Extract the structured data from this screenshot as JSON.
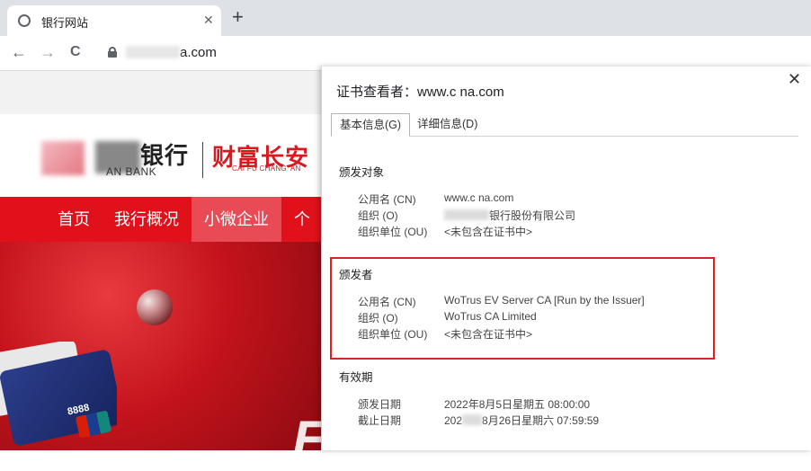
{
  "browser": {
    "tab_title": "银行网站",
    "tab_close": "✕",
    "new_tab": "+",
    "url_suffix": "a.com",
    "nav_back": "←",
    "nav_forward": "→",
    "nav_reload": "C"
  },
  "site": {
    "bank_name": "银行",
    "bank_name_en": "AN BANK",
    "slogan": "财富长安",
    "slogan_en": "CAI FU CHANG' AN",
    "menu": [
      "首页",
      "我行概况",
      "小微企业",
      "个人"
    ],
    "card_number": "8888"
  },
  "dialog": {
    "title": "证书查看者：www.c      na.com",
    "close": "✕",
    "tabs": [
      "基本信息(G)",
      "详细信息(D)"
    ],
    "subject": {
      "heading": "颁发对象",
      "rows": [
        {
          "label": "公用名 (CN)",
          "value": "www.c       na.com"
        },
        {
          "label": "组织 (O)",
          "value": "银行股份有限公司"
        },
        {
          "label": "组织单位 (OU)",
          "value": "<未包含在证书中>"
        }
      ]
    },
    "issuer": {
      "heading": "颁发者",
      "rows": [
        {
          "label": "公用名 (CN)",
          "value": "WoTrus EV Server CA  [Run by the Issuer]"
        },
        {
          "label": "组织 (O)",
          "value": "WoTrus CA Limited"
        },
        {
          "label": "组织单位 (OU)",
          "value": "<未包含在证书中>"
        }
      ]
    },
    "validity": {
      "heading": "有效期",
      "rows": [
        {
          "label": "颁发日期",
          "value": "2022年8月5日星期五 08:00:00"
        },
        {
          "label": "截止日期",
          "value_prefix": "202",
          "value": "8月26日星期六 07:59:59"
        }
      ]
    }
  },
  "colors": {
    "brand_red": "#e0111b",
    "highlight": "#e02020"
  }
}
